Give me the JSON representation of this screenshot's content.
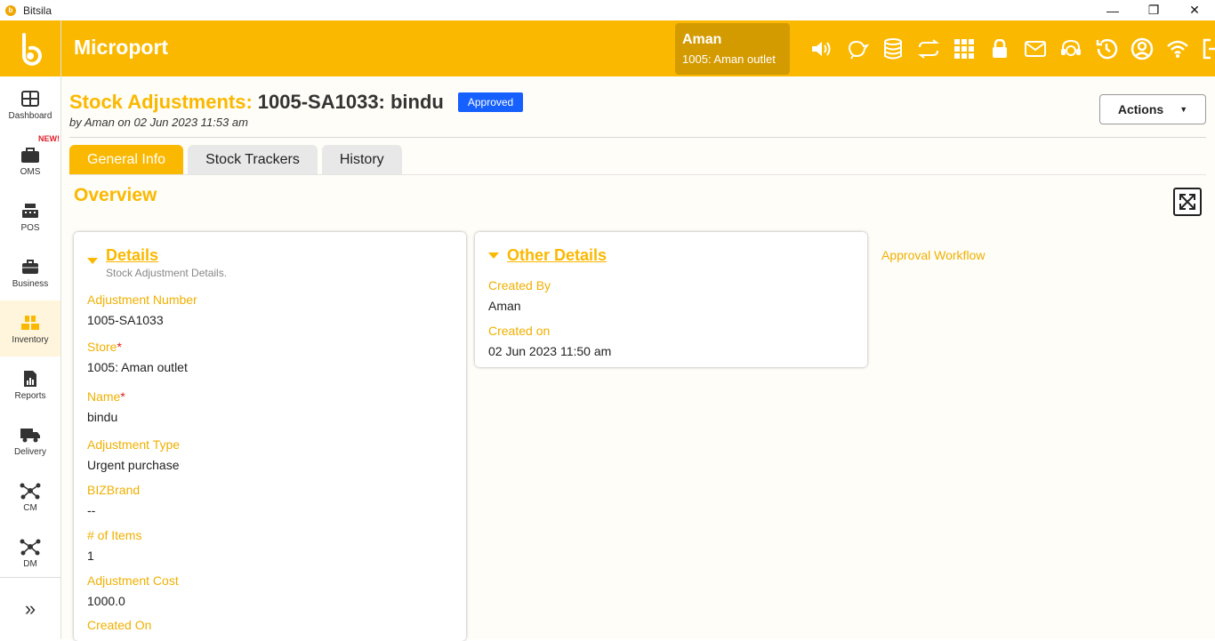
{
  "window": {
    "title": "Bitsila",
    "minimize": "—",
    "maximize": "❐",
    "close": "✕"
  },
  "sidebar": {
    "items": [
      {
        "label": "Dashboard"
      },
      {
        "label": "OMS",
        "badge": "NEW!"
      },
      {
        "label": "POS"
      },
      {
        "label": "Business"
      },
      {
        "label": "Inventory"
      },
      {
        "label": "Reports"
      },
      {
        "label": "Delivery"
      },
      {
        "label": "CM"
      },
      {
        "label": "DM"
      }
    ],
    "expand_icon": "»"
  },
  "topbar": {
    "brand": "Microport",
    "user_name": "Aman",
    "user_store": "1005: Aman outlet"
  },
  "page": {
    "title_prefix": "Stock Adjustments:",
    "title_id": "1005-SA1033: bindu",
    "status": "Approved",
    "byline": "by Aman on 02 Jun 2023 11:53 am",
    "actions_label": "Actions",
    "tabs": [
      "General Info",
      "Stock Trackers",
      "History"
    ],
    "overview": "Overview"
  },
  "details": {
    "title": "Details",
    "subtitle": "Stock Adjustment Details.",
    "fields": [
      {
        "label": "Adjustment Number",
        "value": "1005-SA1033"
      },
      {
        "label": "Store",
        "value": "1005: Aman outlet",
        "required": "*"
      },
      {
        "label": "Name",
        "value": "bindu",
        "required": "*"
      },
      {
        "label": "Adjustment Type",
        "value": "Urgent purchase"
      },
      {
        "label": "BIZBrand",
        "value": "--"
      },
      {
        "label": "# of Items",
        "value": "1"
      },
      {
        "label": "Adjustment Cost",
        "value": "1000.0"
      },
      {
        "label": "Created On",
        "value": ""
      }
    ]
  },
  "other_details": {
    "title": "Other Details",
    "fields": [
      {
        "label": "Created By",
        "value": "Aman"
      },
      {
        "label": "Created on",
        "value": "02 Jun 2023 11:50 am"
      }
    ]
  },
  "approval_workflow": "Approval Workflow",
  "colors": {
    "accent": "#fbb800",
    "accent_dark": "#d49b00",
    "badge_blue": "#1560ff"
  }
}
